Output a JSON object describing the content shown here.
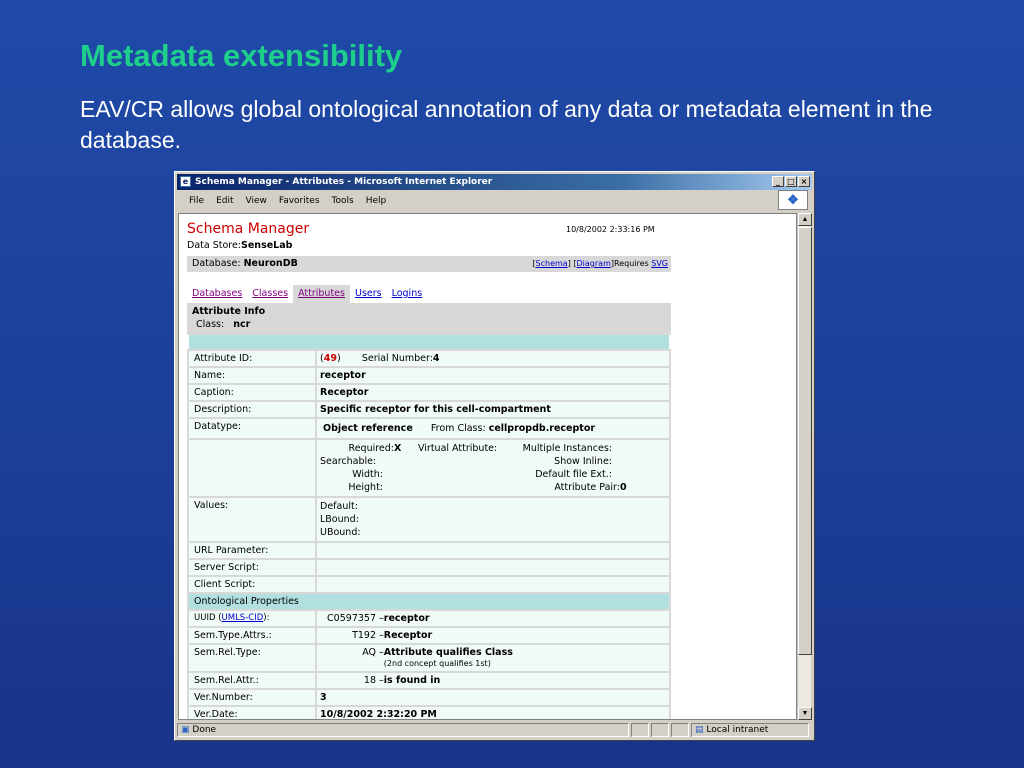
{
  "slide": {
    "title": "Metadata extensibility",
    "text": "EAV/CR allows global ontological annotation of any data or metadata element in the database."
  },
  "browser": {
    "window_title": "Schema Manager - Attributes - Microsoft Internet Explorer",
    "menu": [
      "File",
      "Edit",
      "View",
      "Favorites",
      "Tools",
      "Help"
    ],
    "status_left": "Done",
    "status_zone": "Local intranet"
  },
  "page": {
    "app_title": "Schema Manager",
    "datetime": "10/8/2002 2:33:16 PM",
    "data_store_label": "Data Store:",
    "data_store_value": "SenseLab",
    "database_label": "Database:",
    "database_value": "NeuronDB",
    "schema_link": "Schema",
    "diagram_link": "Diagram",
    "requires_text": "Requires",
    "svg_link": "SVG",
    "tabs": [
      "Databases",
      "Classes",
      "Attributes",
      "Users",
      "Logins"
    ],
    "attribute_info_heading": "Attribute Info",
    "class_label": "Class:",
    "class_value": "ncr",
    "attribute_id_label": "Attribute ID:",
    "attribute_id_value": "49",
    "serial_number_label": "Serial Number:",
    "serial_number_value": "4",
    "name_label": "Name:",
    "name_value": "receptor",
    "caption_label": "Caption:",
    "caption_value": "Receptor",
    "description_label": "Description:",
    "description_value": "Specific receptor for this cell-compartment",
    "datatype_label": "Datatype:",
    "datatype_value": "Object reference",
    "from_class_label": "From Class:",
    "from_class_value": "cellpropdb.receptor",
    "required_label": "Required:",
    "required_value": "X",
    "virtual_attribute_label": "Virtual Attribute:",
    "multiple_instances_label": "Multiple Instances:",
    "searchable_label": "Searchable:",
    "show_inline_label": "Show Inline:",
    "width_label": "Width:",
    "default_file_ext_label": "Default file Ext.:",
    "height_label": "Height:",
    "attribute_pair_label": "Attribute Pair:",
    "attribute_pair_value": "0",
    "values_label": "Values:",
    "default_label": "Default:",
    "lbound_label": "LBound:",
    "ubound_label": "UBound:",
    "url_parameter_label": "URL Parameter:",
    "server_script_label": "Server Script:",
    "client_script_label": "Client Script:",
    "ontological_heading": "Ontological Properties",
    "uuid_label_pre": "UUID (",
    "uuid_link": "UMLS-CID",
    "uuid_label_post": "):",
    "uuid_code": "C0597357",
    "uuid_value": "receptor",
    "sem_type_label": "Sem.Type.Attrs.:",
    "sem_type_code": "T192",
    "sem_type_value": "Receptor",
    "sem_rel_type_label": "Sem.Rel.Type:",
    "sem_rel_type_code": "AQ",
    "sem_rel_type_value": "Attribute qualifies Class",
    "sem_rel_type_note": "(2nd concept qualifies 1st)",
    "sem_rel_attr_label": "Sem.Rel.Attr.:",
    "sem_rel_attr_code": "18",
    "sem_rel_attr_value": "is found in",
    "ver_number_label": "Ver.Number:",
    "ver_number_value": "3",
    "ver_date_label": "Ver.Date:",
    "ver_date_value": "10/8/2002 2:32:20 PM"
  }
}
